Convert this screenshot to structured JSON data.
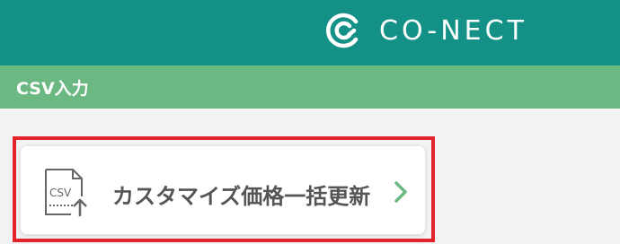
{
  "header": {
    "brand_name": "CO-NECT",
    "background_color": "#139186",
    "logo_icon": "conect-logo-icon"
  },
  "section": {
    "title": "CSV入力",
    "background_color": "#6cb883"
  },
  "menu": {
    "items": [
      {
        "label": "カスタマイズ価格一括更新",
        "icon": "csv-upload-icon",
        "icon_text": "CSV",
        "trailing_icon": "chevron-right-icon",
        "highlighted": true
      }
    ]
  },
  "colors": {
    "highlight_border": "#e3222b",
    "accent": "#6cb883",
    "page_background": "#f2f2f2"
  }
}
